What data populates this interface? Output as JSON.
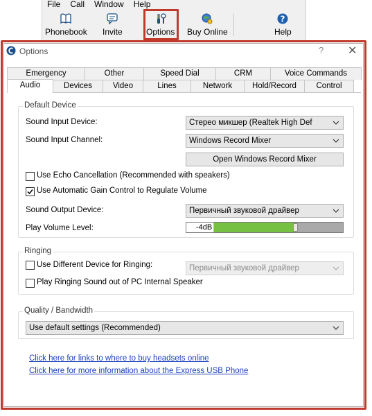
{
  "menu": [
    "File",
    "Call",
    "Window",
    "Help"
  ],
  "toolbar": {
    "phonebook": "Phonebook",
    "invite": "Invite",
    "options": "Options",
    "buy_online": "Buy Online",
    "help": "Help"
  },
  "dialog": {
    "title": "Options",
    "help_glyph": "?",
    "close_glyph": "✕"
  },
  "tabs_row1": [
    "Emergency",
    "Other",
    "Speed Dial",
    "CRM",
    "Voice Commands"
  ],
  "tabs_row2": [
    "Audio",
    "Devices",
    "Video",
    "Lines",
    "Network",
    "Hold/Record",
    "Control"
  ],
  "active_tab": "Audio",
  "default_device": {
    "title": "Default Device",
    "sound_input_device_label": "Sound Input Device:",
    "sound_input_device_value": "Стерео микшер (Realtek High Def",
    "sound_input_channel_label": "Sound Input Channel:",
    "sound_input_channel_value": "Windows Record Mixer",
    "open_mixer_button": "Open Windows Record Mixer",
    "echo_cancel_label": "Use Echo Cancellation (Recommended with speakers)",
    "echo_cancel_checked": false,
    "agc_label": "Use Automatic Gain Control to Regulate Volume",
    "agc_checked": true,
    "sound_output_device_label": "Sound Output Device:",
    "sound_output_device_value": "Первичный звуковой драйвер",
    "play_volume_label": "Play Volume Level:",
    "play_volume_value": "-4dB",
    "play_volume_fraction": 0.7
  },
  "ringing": {
    "title": "Ringing",
    "use_different_device_label": "Use Different Device for Ringing:",
    "use_different_device_checked": false,
    "ringing_device_value": "Первичный звуковой драйвер",
    "internal_speaker_label": "Play Ringing Sound out of PC Internal Speaker",
    "internal_speaker_checked": false
  },
  "quality": {
    "title": "Quality / Bandwidth",
    "value": "Use default settings (Recommended)"
  },
  "links": {
    "headsets": "Click here for links to where to buy headsets online",
    "usb_phone": "Click here for more information about the Express USB Phone"
  },
  "colors": {
    "highlight": "#c0392b",
    "link": "#1a3fbf",
    "volume_fill": "#76c043"
  }
}
